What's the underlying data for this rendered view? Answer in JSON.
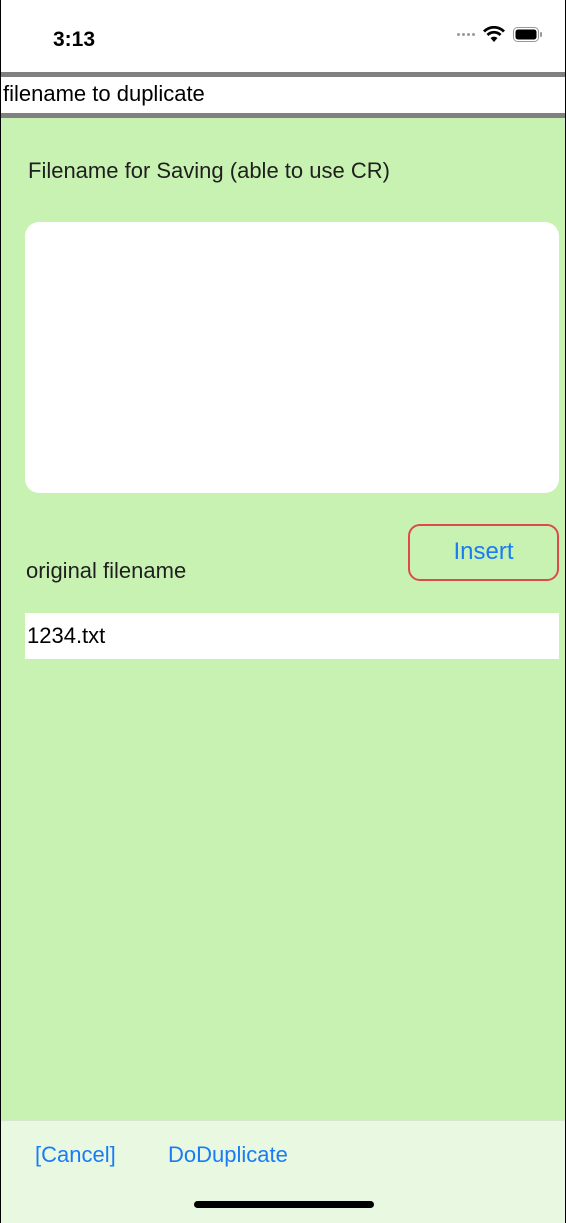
{
  "status_bar": {
    "time": "3:13",
    "icons": [
      "signal-icon",
      "wifi-icon",
      "battery-icon"
    ]
  },
  "title_bar": {
    "title": "filename to duplicate"
  },
  "main": {
    "save_label": "Filename for Saving (able to use CR)",
    "save_value": "",
    "insert_label": "Insert",
    "original_label": "original filename",
    "original_value": "1234.txt"
  },
  "toolbar": {
    "cancel_label": "[Cancel]",
    "duplicate_label": "DoDuplicate"
  },
  "colors": {
    "background": "#c8f2b2",
    "toolbar": "#e9f8e1",
    "accent": "#1a7cf5",
    "focus_ring": "#e0484f"
  }
}
